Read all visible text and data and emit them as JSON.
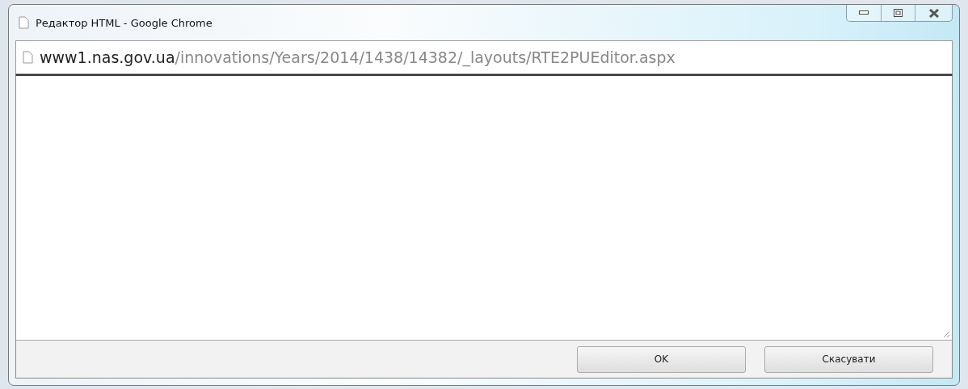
{
  "window": {
    "title": "Редактор HTML - Google Chrome"
  },
  "address_bar": {
    "host": "www1.nas.gov.ua",
    "path": "/innovations/Years/2014/1438/14382/_layouts/RTE2PUEditor.aspx"
  },
  "buttons": [
    "OK",
    "Скасувати"
  ]
}
